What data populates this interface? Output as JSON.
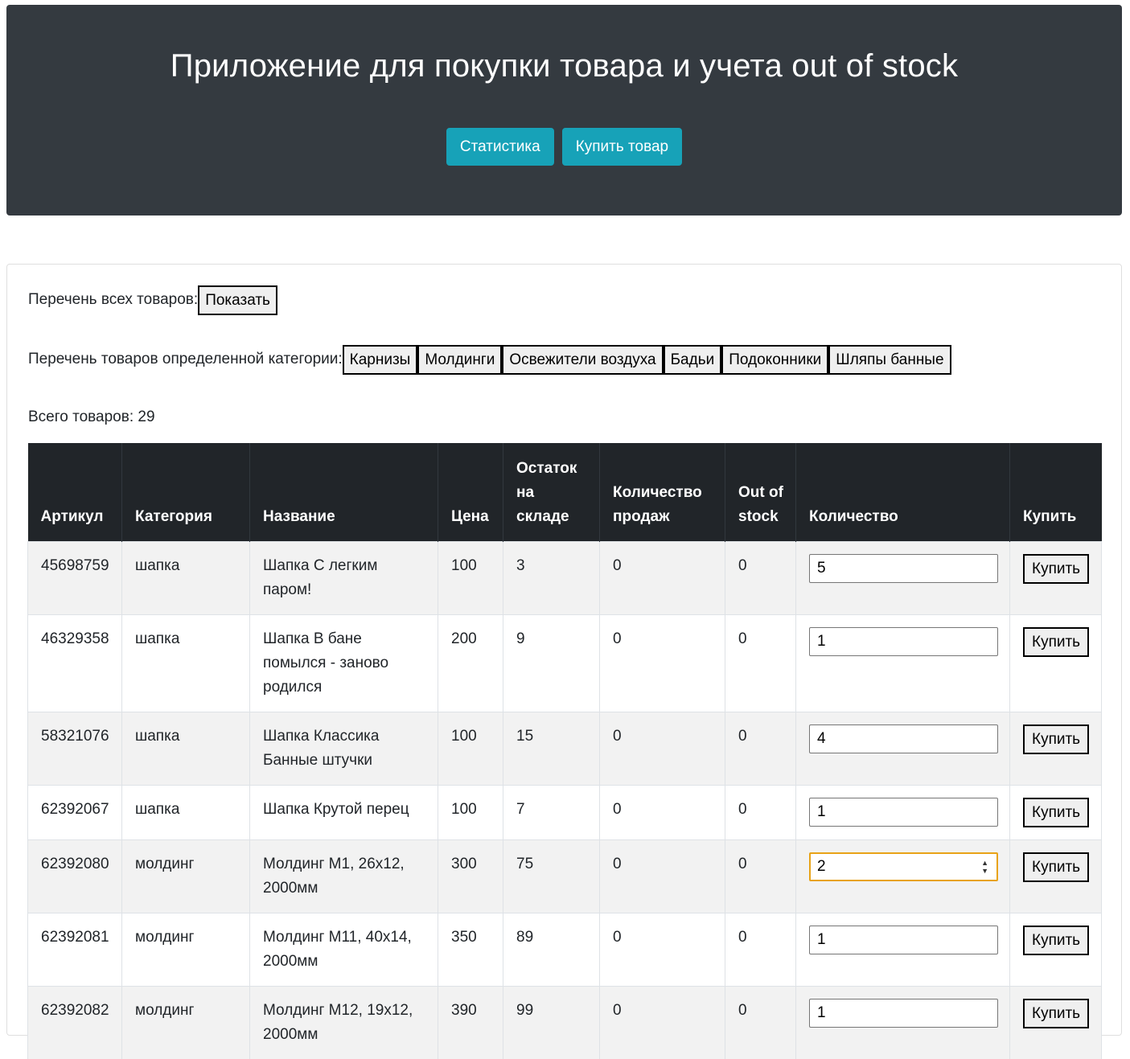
{
  "header": {
    "title": "Приложение для покупки товара и учета out of stock",
    "buttons": [
      "Статистика",
      "Купить товар"
    ]
  },
  "filters": {
    "all_label": "Перечень всех товаров:",
    "all_button": "Показать",
    "category_label": "Перечень товаров определенной категории:",
    "categories": [
      "Карнизы",
      "Молдинги",
      "Освежители воздуха",
      "Бадьи",
      "Подоконники",
      "Шляпы банные"
    ],
    "total_text": "Всего товаров: 29"
  },
  "table": {
    "columns": [
      "Артикул",
      "Категория",
      "Название",
      "Цена",
      "Остаток на складе",
      "Количество продаж",
      "Out of stock",
      "Количество",
      "Купить"
    ],
    "buy_label": "Купить",
    "rows": [
      {
        "sku": "45698759",
        "category": "шапка",
        "name": "Шапка С легким паром!",
        "price": "100",
        "stock": "3",
        "sales": "0",
        "oos": "0",
        "qty": "5"
      },
      {
        "sku": "46329358",
        "category": "шапка",
        "name": "Шапка В бане помылся - заново родился",
        "price": "200",
        "stock": "9",
        "sales": "0",
        "oos": "0",
        "qty": "1"
      },
      {
        "sku": "58321076",
        "category": "шапка",
        "name": "Шапка Классика Банные штучки",
        "price": "100",
        "stock": "15",
        "sales": "0",
        "oos": "0",
        "qty": "4"
      },
      {
        "sku": "62392067",
        "category": "шапка",
        "name": "Шапка Крутой перец",
        "price": "100",
        "stock": "7",
        "sales": "0",
        "oos": "0",
        "qty": "1"
      },
      {
        "sku": "62392080",
        "category": "молдинг",
        "name": "Молдинг М1, 26х12, 2000мм",
        "price": "300",
        "stock": "75",
        "sales": "0",
        "oos": "0",
        "qty": "2",
        "focused": true
      },
      {
        "sku": "62392081",
        "category": "молдинг",
        "name": "Молдинг М11, 40х14, 2000мм",
        "price": "350",
        "stock": "89",
        "sales": "0",
        "oos": "0",
        "qty": "1"
      },
      {
        "sku": "62392082",
        "category": "молдинг",
        "name": "Молдинг М12, 19х12, 2000мм",
        "price": "390",
        "stock": "99",
        "sales": "0",
        "oos": "0",
        "qty": "1"
      }
    ]
  },
  "colors": {
    "header_bg": "#343a40",
    "accent": "#17a2b8",
    "table_head": "#212529",
    "focus": "#e8a317"
  }
}
